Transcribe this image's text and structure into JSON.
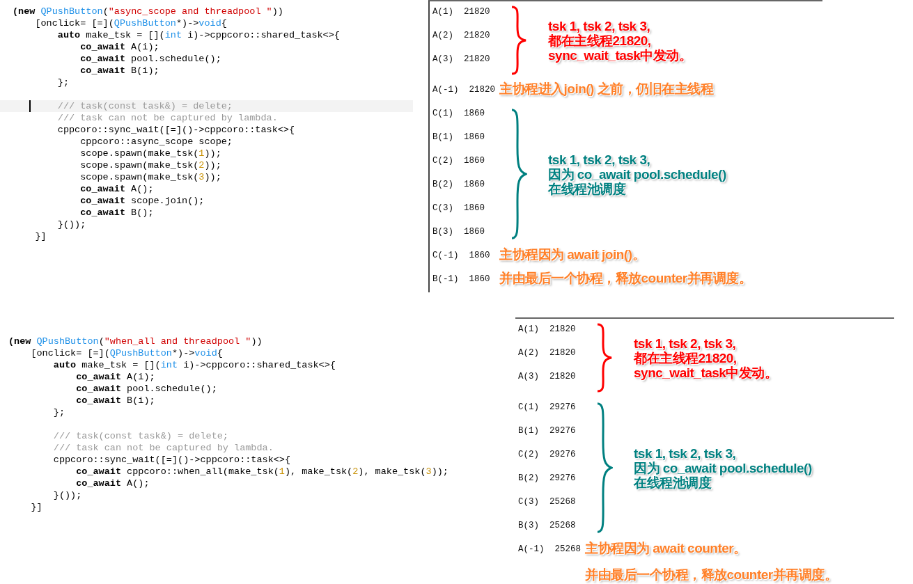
{
  "panels": [
    {
      "editor": {
        "lines": [
          {
            "current": false,
            "segments": [
              {
                "kind": "keyword",
                "text": "(new "
              },
              {
                "kind": "type",
                "text": "QPushButton"
              },
              {
                "kind": "plain",
                "text": "("
              },
              {
                "kind": "string",
                "text": "\"async_scope and threadpool \""
              },
              {
                "kind": "plain",
                "text": "))"
              }
            ]
          },
          {
            "current": false,
            "segments": [
              {
                "kind": "plain",
                "text": "    [onclick= [=]("
              },
              {
                "kind": "type",
                "text": "QPushButton"
              },
              {
                "kind": "plain",
                "text": "*)->"
              },
              {
                "kind": "type",
                "text": "void"
              },
              {
                "kind": "plain",
                "text": "{"
              }
            ]
          },
          {
            "current": false,
            "segments": [
              {
                "kind": "keyword",
                "text": "        auto"
              },
              {
                "kind": "plain",
                "text": " make_tsk = []("
              },
              {
                "kind": "type",
                "text": "int"
              },
              {
                "kind": "plain",
                "text": " i)->cppcoro::shared_task<>{"
              }
            ]
          },
          {
            "current": false,
            "segments": [
              {
                "kind": "keyword",
                "text": "            co_await"
              },
              {
                "kind": "plain",
                "text": " A(i);"
              }
            ]
          },
          {
            "current": false,
            "segments": [
              {
                "kind": "keyword",
                "text": "            co_await"
              },
              {
                "kind": "plain",
                "text": " pool.schedule();"
              }
            ]
          },
          {
            "current": false,
            "segments": [
              {
                "kind": "keyword",
                "text": "            co_await"
              },
              {
                "kind": "plain",
                "text": " B(i);"
              }
            ]
          },
          {
            "current": false,
            "segments": [
              {
                "kind": "plain",
                "text": "        };"
              }
            ]
          },
          {
            "current": false
          },
          {
            "current": true,
            "segments": [
              {
                "kind": "comment",
                "text": "        /// task(const task&) = delete;"
              }
            ]
          },
          {
            "current": false,
            "segments": [
              {
                "kind": "comment",
                "text": "        /// task can not be captured by lambda."
              }
            ]
          },
          {
            "current": false,
            "segments": [
              {
                "kind": "plain",
                "text": "        cppcoro::sync_wait([=]()->cppcoro::task<>{"
              }
            ]
          },
          {
            "current": false,
            "segments": [
              {
                "kind": "plain",
                "text": "            cppcoro::async_scope scope;"
              }
            ]
          },
          {
            "current": false,
            "segments": [
              {
                "kind": "plain",
                "text": "            scope.spawn(make_tsk("
              },
              {
                "kind": "number",
                "text": "1"
              },
              {
                "kind": "plain",
                "text": "));"
              }
            ]
          },
          {
            "current": false,
            "segments": [
              {
                "kind": "plain",
                "text": "            scope.spawn(make_tsk("
              },
              {
                "kind": "number",
                "text": "2"
              },
              {
                "kind": "plain",
                "text": "));"
              }
            ]
          },
          {
            "current": false,
            "segments": [
              {
                "kind": "plain",
                "text": "            scope.spawn(make_tsk("
              },
              {
                "kind": "number",
                "text": "3"
              },
              {
                "kind": "plain",
                "text": "));"
              }
            ]
          },
          {
            "current": false,
            "segments": [
              {
                "kind": "keyword",
                "text": "            co_await"
              },
              {
                "kind": "plain",
                "text": " A();"
              }
            ]
          },
          {
            "current": false,
            "segments": [
              {
                "kind": "keyword",
                "text": "            co_await"
              },
              {
                "kind": "plain",
                "text": " scope.join();"
              }
            ]
          },
          {
            "current": false,
            "segments": [
              {
                "kind": "keyword",
                "text": "            co_await"
              },
              {
                "kind": "plain",
                "text": " B();"
              }
            ]
          },
          {
            "current": false,
            "segments": [
              {
                "kind": "plain",
                "text": "        }());"
              }
            ]
          },
          {
            "current": false,
            "segments": [
              {
                "kind": "plain",
                "text": "    }]"
              }
            ]
          }
        ]
      },
      "output": {
        "left_border": true,
        "groups": [
          {
            "kind": "brace",
            "color": "#ff0000",
            "entries": [
              "A(1)  21820",
              "A(2)  21820",
              "A(3)  21820"
            ],
            "note": [
              "tsk 1, tsk 2, tsk 3,",
              "都在主线程21820,",
              "sync_wait_task中发动。"
            ]
          },
          {
            "kind": "line",
            "color": "#ff7f27",
            "entries": [
              "A(-1)  21820"
            ],
            "note": [
              "主协程进入join() 之前，仍旧在主线程"
            ]
          },
          {
            "kind": "brace",
            "color": "#008080",
            "entries": [
              "C(1)  1860",
              "B(1)  1860",
              "C(2)  1860",
              "B(2)  1860",
              "C(3)  1860",
              "B(3)  1860"
            ],
            "note": [
              "tsk 1, tsk 2, tsk 3,",
              "因为 co_await  pool.schedule()",
              "在线程池调度"
            ]
          },
          {
            "kind": "line",
            "color": "#ff7f27",
            "entries": [
              "C(-1)  1860"
            ],
            "note": [
              "主协程因为 await join()。"
            ]
          },
          {
            "kind": "line",
            "color": "#ff7f27",
            "entries": [
              "B(-1)  1860"
            ],
            "note": [
              "并由最后一个协程，释放counter并再调度。"
            ]
          }
        ]
      }
    },
    {
      "editor": {
        "lines": [
          {
            "current": false,
            "segments": [
              {
                "kind": "keyword",
                "text": "(new "
              },
              {
                "kind": "type",
                "text": "QPushButton"
              },
              {
                "kind": "plain",
                "text": "("
              },
              {
                "kind": "string",
                "text": "\"when_all and threadpool \""
              },
              {
                "kind": "plain",
                "text": "))"
              }
            ]
          },
          {
            "current": false,
            "segments": [
              {
                "kind": "plain",
                "text": "    [onclick= [=]("
              },
              {
                "kind": "type",
                "text": "QPushButton"
              },
              {
                "kind": "plain",
                "text": "*)->"
              },
              {
                "kind": "type",
                "text": "void"
              },
              {
                "kind": "plain",
                "text": "{"
              }
            ]
          },
          {
            "current": false,
            "segments": [
              {
                "kind": "keyword",
                "text": "        auto"
              },
              {
                "kind": "plain",
                "text": " make_tsk = []("
              },
              {
                "kind": "type",
                "text": "int"
              },
              {
                "kind": "plain",
                "text": " i)->cppcoro::shared_task<>{"
              }
            ]
          },
          {
            "current": false,
            "segments": [
              {
                "kind": "keyword",
                "text": "            co_await"
              },
              {
                "kind": "plain",
                "text": " A(i);"
              }
            ]
          },
          {
            "current": false,
            "segments": [
              {
                "kind": "keyword",
                "text": "            co_await"
              },
              {
                "kind": "plain",
                "text": " pool.schedule();"
              }
            ]
          },
          {
            "current": false,
            "segments": [
              {
                "kind": "keyword",
                "text": "            co_await"
              },
              {
                "kind": "plain",
                "text": " B(i);"
              }
            ]
          },
          {
            "current": false,
            "segments": [
              {
                "kind": "plain",
                "text": "        };"
              }
            ]
          },
          {
            "current": false
          },
          {
            "current": false,
            "segments": [
              {
                "kind": "comment",
                "text": "        /// task(const task&) = delete;"
              }
            ]
          },
          {
            "current": false,
            "segments": [
              {
                "kind": "comment",
                "text": "        /// task can not be captured by lambda."
              }
            ]
          },
          {
            "current": false,
            "segments": [
              {
                "kind": "plain",
                "text": "        cppcoro::sync_wait([=]()->cppcoro::task<>{"
              }
            ]
          },
          {
            "current": false,
            "segments": [
              {
                "kind": "keyword",
                "text": "            co_await"
              },
              {
                "kind": "plain",
                "text": " cppcoro::when_all(make_tsk("
              },
              {
                "kind": "number",
                "text": "1"
              },
              {
                "kind": "plain",
                "text": "), make_tsk("
              },
              {
                "kind": "number",
                "text": "2"
              },
              {
                "kind": "plain",
                "text": "), make_tsk("
              },
              {
                "kind": "number",
                "text": "3"
              },
              {
                "kind": "plain",
                "text": "));"
              }
            ]
          },
          {
            "current": false,
            "segments": [
              {
                "kind": "keyword",
                "text": "            co_await"
              },
              {
                "kind": "plain",
                "text": " A();"
              }
            ]
          },
          {
            "current": false,
            "segments": [
              {
                "kind": "plain",
                "text": "        }());"
              }
            ]
          },
          {
            "current": false,
            "segments": [
              {
                "kind": "plain",
                "text": "    }]"
              }
            ]
          }
        ]
      },
      "output": {
        "left_border": false,
        "groups": [
          {
            "kind": "brace",
            "color": "#ff0000",
            "entries": [
              "A(1)  21820",
              "A(2)  21820",
              "A(3)  21820"
            ],
            "note": [
              "tsk 1, tsk 2, tsk 3,",
              "都在主线程21820,",
              "sync_wait_task中发动。"
            ]
          },
          {
            "kind": "brace",
            "color": "#008080",
            "entries": [
              "C(1)  29276",
              "B(1)  29276",
              "C(2)  29276",
              "B(2)  29276",
              "C(3)  25268",
              "B(3)  25268"
            ],
            "note": [
              "tsk 1, tsk 2, tsk 3,",
              "因为 co_await  pool.schedule()",
              "在线程池调度"
            ]
          },
          {
            "kind": "line",
            "color": "#ff7f27",
            "entries": [
              "A(-1)  25268"
            ],
            "note": [
              "主协程因为 await counter。"
            ]
          },
          {
            "kind": "line",
            "color": "#ff7f27",
            "note": [
              "并由最后一个协程，释放counter并再调度。"
            ]
          }
        ]
      }
    }
  ]
}
